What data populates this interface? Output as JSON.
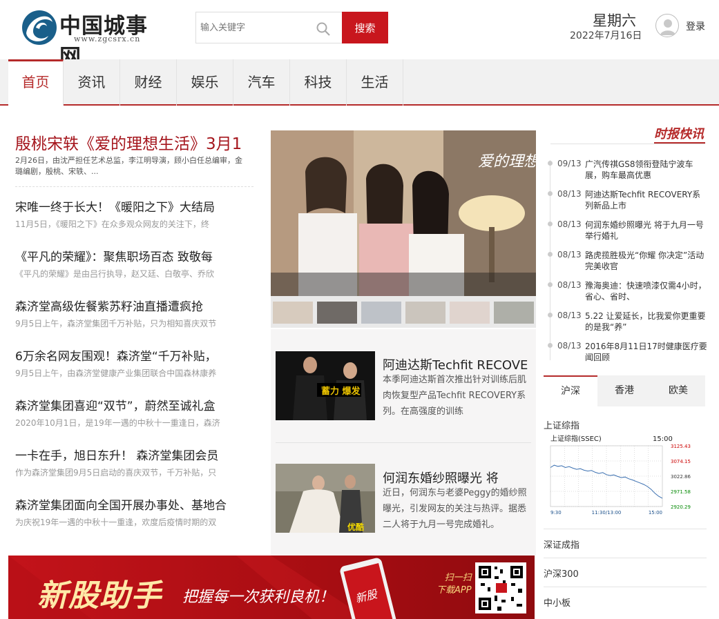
{
  "header": {
    "logo_title": "中国城事网",
    "logo_url": "www.zgcsrx.cn",
    "search_placeholder": "输入关键字",
    "search_button": "搜索",
    "weekday": "星期六",
    "date": "2022年7月16日",
    "login": "登录"
  },
  "nav": {
    "items": [
      "首页",
      "资讯",
      "财经",
      "娱乐",
      "汽车",
      "科技",
      "生活"
    ],
    "active": "首页"
  },
  "feature": {
    "title": "殷桃宋轶《爱的理想生活》3月1",
    "desc": "2月26日，由沈严担任艺术总监，李江明导演，顾小白任总编审，金璐编剧，殷桃、宋轶、..."
  },
  "news": [
    {
      "title": "宋唯一终于长大！《暖阳之下》大结局",
      "desc": "11月5日，《暖阳之下》在众多观众网友的关注下，终"
    },
    {
      "title": "《平凡的荣耀》：聚焦职场百态 致敬每",
      "desc": "《平凡的荣耀》是由吕行执导，赵又廷、白敬亭、乔欣"
    },
    {
      "title": "森济堂高级佐餐紫苏籽油直播遭疯抢",
      "desc": "9月5日上午，森济堂集团千万补贴，只为相知喜庆双节"
    },
    {
      "title": "6万余名网友围观！森济堂“千万补贴，",
      "desc": "9月5日上午，由森济堂健康产业集团联合中国森林康养"
    },
    {
      "title": "森济堂集团喜迎“双节”，蔚然至诚礼盒",
      "desc": "2020年10月1日，是19年一遇的中秋十一重逢日，森济"
    },
    {
      "title": "一卡在手，旭日东升！ 森济堂集团会员",
      "desc": "作为森济堂集团9月5日启动的喜庆双节，千万补贴，只"
    },
    {
      "title": "森济堂集团面向全国开展办事处、基地合",
      "desc": "为庆祝19年一遇的中秋十一重逢，欢度后疫情时期的双"
    }
  ],
  "slider": {
    "caption_art": "爱的理想生活"
  },
  "cards": [
    {
      "title": "阿迪达斯Techfit RECOVE",
      "desc": "本季阿迪达斯首次推出针对训练后肌肉恢复型产品Techfit RECOVERY系列。在高强度的训练",
      "img_text": "蓄力 爆发"
    },
    {
      "title": "何润东婚纱照曝光 将",
      "desc": "近日，何润东与老婆Peggy的婚纱照曝光，引发网友的关注与热评。据悉二人将于九月一号完成婚礼。",
      "img_text": "优酷"
    }
  ],
  "banner": {
    "big": "新股助手",
    "sub": "把握每一次获利良机！",
    "scan1": "扫一扫",
    "scan2": "下载APP",
    "phone_text": "新股"
  },
  "flash": {
    "title": "时报快讯",
    "items": [
      {
        "date": "09/13",
        "text": "广汽传祺GS8领衔登陆宁波车展，购车最高优惠"
      },
      {
        "date": "08/13",
        "text": "阿迪达斯Techfit RECOVERY系列新品上市"
      },
      {
        "date": "08/13",
        "text": "何润东婚纱照曝光 将于九月一号举行婚礼"
      },
      {
        "date": "08/13",
        "text": "路虎揽胜极光“你耀 你决定”活动完美收官"
      },
      {
        "date": "08/13",
        "text": "豫海奥迪：快速喷漆仅需4小时，省心、省时、"
      },
      {
        "date": "08/13",
        "text": "5.22 让爱延长，比我爱你更重要的是我“养”"
      },
      {
        "date": "08/13",
        "text": "2016年8月11日17时健康医疗要闻回顾"
      }
    ]
  },
  "market": {
    "tabs": [
      "沪深",
      "香港",
      "欧美"
    ],
    "active": "沪深",
    "label": "上证综指",
    "links": [
      "深证成指",
      "沪深300",
      "中小板"
    ]
  },
  "chart_data": {
    "type": "line",
    "title": "上证综指(SSEC)",
    "time_label": "15:00",
    "x_ticks": [
      "9:30",
      "11:30/13:00",
      "15:00"
    ],
    "y_ticks": [
      3125.43,
      3074.15,
      3022.86,
      2971.58,
      2920.29
    ],
    "ylim": [
      2920.29,
      3125.43
    ],
    "values": [
      3052,
      3060,
      3056,
      3058,
      3052,
      3055,
      3050,
      3046,
      3048,
      3043,
      3040,
      3042,
      3036,
      3032,
      3035,
      3028,
      3025,
      3027,
      3022,
      3018,
      3020,
      3014,
      3010,
      3005,
      3000,
      2995,
      2988,
      2978,
      2965,
      2955,
      2948
    ],
    "colors": {
      "line": "#3a6fb0",
      "up": "#cc0000",
      "down": "#008800"
    }
  }
}
